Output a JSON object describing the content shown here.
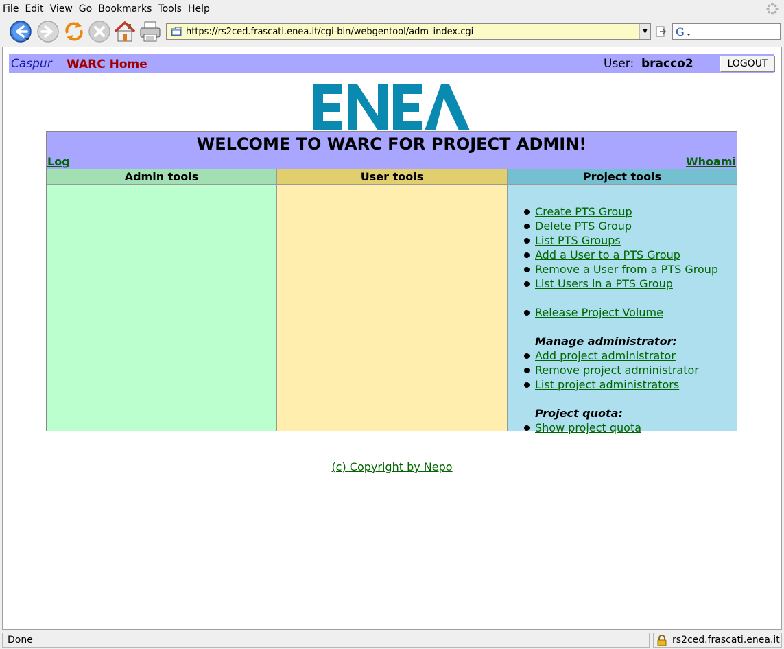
{
  "browser": {
    "menu": [
      "File",
      "Edit",
      "View",
      "Go",
      "Bookmarks",
      "Tools",
      "Help"
    ],
    "url": "https://rs2ced.frascati.enea.it/cgi-bin/webgentool/adm_index.cgi",
    "status": "Done",
    "host": "rs2ced.frascati.enea.it"
  },
  "topbar": {
    "brand": "Caspur",
    "home_link": "WARC Home",
    "user_label": "User:",
    "user_name": "bracco2",
    "logout": "LOGOUT"
  },
  "logo": {
    "text": "ENEA",
    "color": "#0a8ab0"
  },
  "welcome": {
    "title": "WELCOME TO WARC FOR PROJECT ADMIN!",
    "log_link": "Log",
    "whoami_link": "Whoami"
  },
  "columns": {
    "admin": "Admin tools",
    "user": "User tools",
    "project": "Project tools"
  },
  "project_tools": {
    "pts": [
      "Create PTS Group",
      "Delete PTS Group",
      "List PTS Groups",
      "Add a User to a PTS Group",
      "Remove a User from a PTS Group",
      "List Users in a PTS Group"
    ],
    "volume": "Release Project Volume",
    "manage_admin_title": "Manage administrator:",
    "admin_links": [
      "Add project administrator",
      "Remove project administrator",
      "List project administrators"
    ],
    "quota_title": "Project quota:",
    "quota_link": "Show project quota"
  },
  "footer": {
    "copyright": "(c) Copyright by Nepo"
  },
  "colors": {
    "header_bg": "#a9a6ff",
    "admin_bg": "#bbffce",
    "user_bg": "#ffeeae",
    "project_bg": "#addfee",
    "link": "#006600"
  }
}
